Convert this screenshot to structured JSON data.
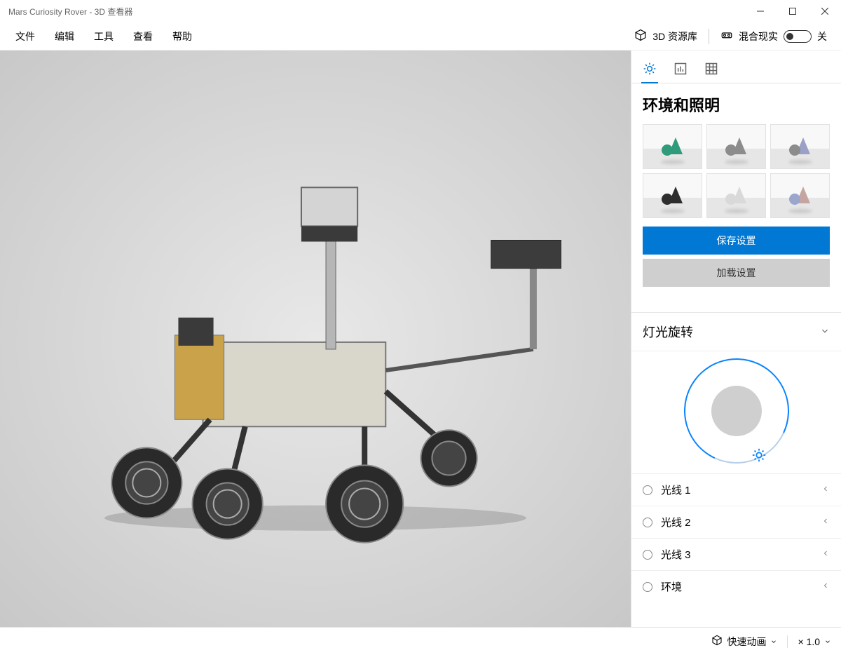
{
  "titlebar": {
    "title": "Mars Curiosity Rover - 3D 查看器"
  },
  "menubar": {
    "items": [
      "文件",
      "编辑",
      "工具",
      "查看",
      "帮助"
    ],
    "library_label": "3D 资源库",
    "mixed_reality_label": "混合现实",
    "mixed_reality_state": "关"
  },
  "sidebar": {
    "panel_title": "环境和照明",
    "thumbs": [
      {
        "cone": "#2f9b7a",
        "ball": "#2f9b7a"
      },
      {
        "cone": "#8c8c8c",
        "ball": "#8c8c8c"
      },
      {
        "cone": "#9aa0c6",
        "ball": "#8c8c8c"
      },
      {
        "cone": "#2e2e2e",
        "ball": "#2e2e2e"
      },
      {
        "cone": "#d9d9d9",
        "ball": "#d9d9d9"
      },
      {
        "cone": "#c6a5a0",
        "ball": "#9aa6cc"
      }
    ],
    "save_button": "保存设置",
    "load_button": "加载设置",
    "rotation_header": "灯光旋转",
    "lights": [
      {
        "label": "光线 1"
      },
      {
        "label": "光线 2"
      },
      {
        "label": "光线 3"
      },
      {
        "label": "环境"
      }
    ]
  },
  "statusbar": {
    "anim_label": "快速动画",
    "zoom_label": "× 1.0"
  }
}
